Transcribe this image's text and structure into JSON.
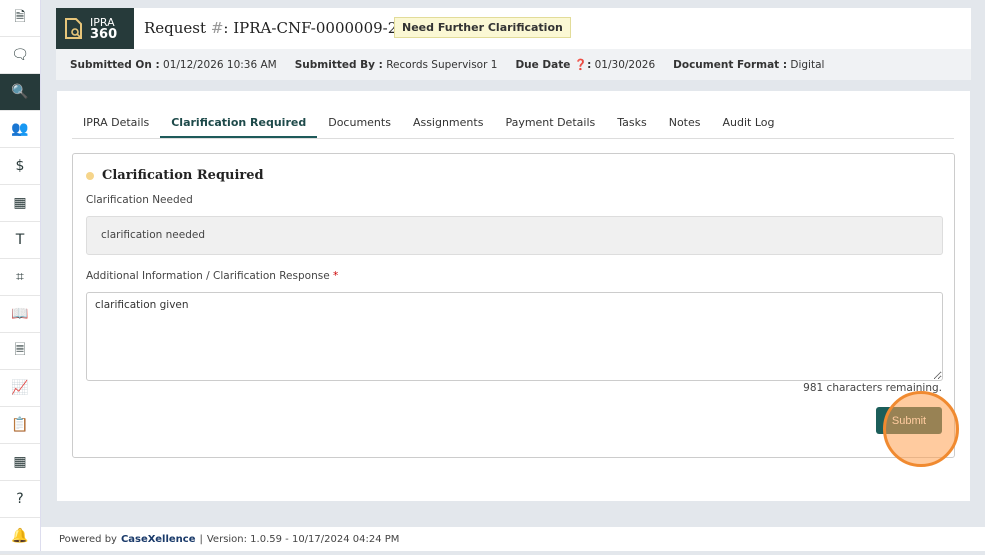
{
  "sidebar": {
    "items": [
      {
        "icon": "document-icon",
        "g": "🗎"
      },
      {
        "icon": "message-icon",
        "g": "🗨"
      },
      {
        "icon": "document-search-icon",
        "g": "🔍"
      },
      {
        "icon": "users-icon",
        "g": "👥"
      },
      {
        "icon": "invoice-icon",
        "g": "$"
      },
      {
        "icon": "building-icon",
        "g": "▦"
      },
      {
        "icon": "template-icon",
        "g": "T"
      },
      {
        "icon": "scan-icon",
        "g": "⌗"
      },
      {
        "icon": "book-icon",
        "g": "📖"
      },
      {
        "icon": "file-icon",
        "g": "🗏"
      },
      {
        "icon": "chart-icon",
        "g": "📈"
      },
      {
        "icon": "clipboard-clock-icon",
        "g": "📋"
      },
      {
        "icon": "calendar-icon",
        "g": "▦"
      },
      {
        "icon": "help-document-icon",
        "g": "?"
      },
      {
        "icon": "bell-icon",
        "g": "🔔"
      }
    ],
    "active_index": 2
  },
  "header": {
    "logo_line1": "IPRA",
    "logo_line2": "360",
    "title_prefix": "Request",
    "title_hash": "#",
    "title_sep": ":",
    "request_id": "IPRA-CNF-0000009-26",
    "status": "Need Further Clarification",
    "meta": [
      {
        "label": "Submitted On :",
        "value": "01/12/2026 10:36 AM"
      },
      {
        "label": "Submitted By :",
        "value": "Records Supervisor 1"
      },
      {
        "label": "Due Date ❓:",
        "value": "01/30/2026"
      },
      {
        "label": "Document Format :",
        "value": "Digital"
      }
    ]
  },
  "tabs": [
    "IPRA Details",
    "Clarification Required",
    "Documents",
    "Assignments",
    "Payment Details",
    "Tasks",
    "Notes",
    "Audit Log"
  ],
  "active_tab": 1,
  "panel": {
    "title": "Clarification Required",
    "needed_label": "Clarification Needed",
    "needed_value": "clarification needed",
    "response_label": "Additional Information / Clarification Response",
    "required_mark": "*",
    "response_value": "clarification given",
    "remaining": "981 characters remaining.",
    "submit_label": "Submit"
  },
  "footer": {
    "powered": "Powered by",
    "brand": "CaseXellence",
    "sep": "|",
    "version": "Version: 1.0.59 - 10/17/2024 04:24 PM"
  }
}
